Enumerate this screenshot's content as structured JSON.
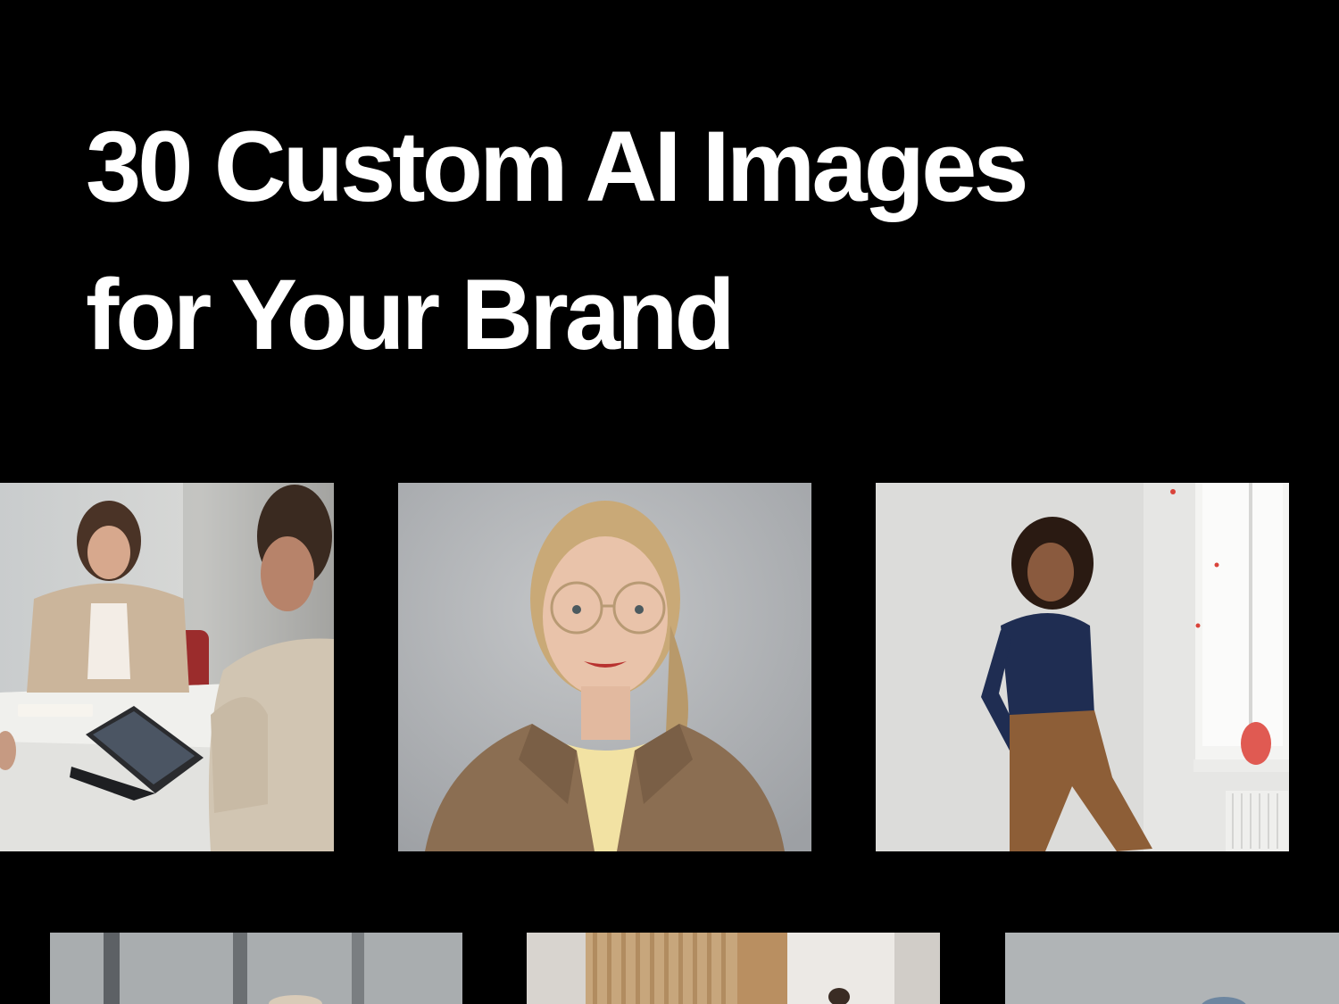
{
  "headline": {
    "line1": "30 Custom AI Images",
    "line2": "for Your Brand"
  },
  "colors": {
    "background": "#000000",
    "text": "#ffffff"
  },
  "gallery": [
    {
      "subject": "meeting-photo"
    },
    {
      "subject": "portrait-photo"
    },
    {
      "subject": "wall-portrait-photo"
    },
    {
      "subject": "window-photo"
    },
    {
      "subject": "office-hallway-photo"
    },
    {
      "subject": "grey-interior-photo"
    }
  ]
}
